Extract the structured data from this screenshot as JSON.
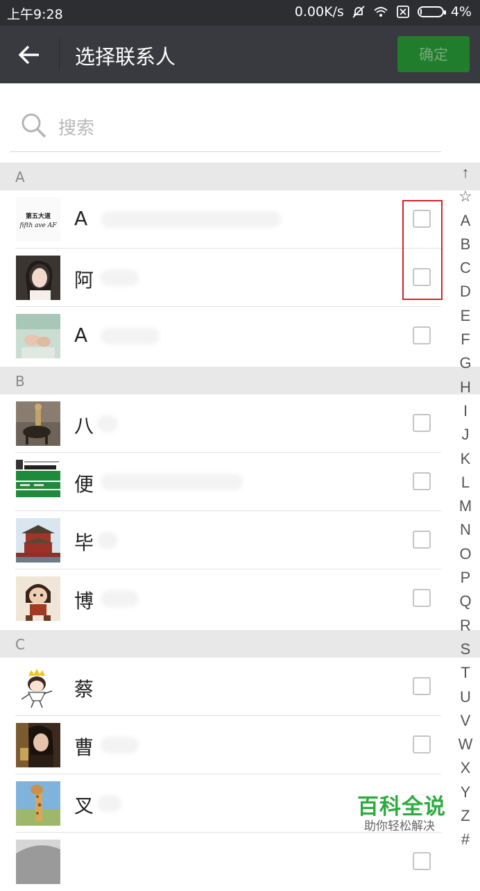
{
  "status_bar": {
    "time": "上午9:28",
    "speed": "0.00K/s",
    "battery_percent": "4%",
    "battery_level": 0.04
  },
  "header": {
    "title": "选择联系人",
    "confirm_label": "确定"
  },
  "search": {
    "placeholder": "搜索"
  },
  "sections": [
    {
      "letter": "A",
      "contacts": [
        {
          "name": "A",
          "avatar": "fifth-ave-logo-avatar",
          "checked": false
        },
        {
          "name": "阿",
          "avatar": "girl-photo-avatar",
          "checked": false
        },
        {
          "name": "A",
          "avatar": "hands-photo-avatar",
          "checked": false
        }
      ]
    },
    {
      "letter": "B",
      "contacts": [
        {
          "name": "八",
          "avatar": "statue-photo-avatar",
          "checked": false
        },
        {
          "name": "便",
          "avatar": "business-card-avatar",
          "checked": false
        },
        {
          "name": "毕",
          "avatar": "pavilion-photo-avatar",
          "checked": false
        },
        {
          "name": "博",
          "avatar": "cartoon-character-avatar",
          "checked": false
        }
      ]
    },
    {
      "letter": "C",
      "contacts": [
        {
          "name": "蔡",
          "avatar": "cartoon-girl-avatar",
          "checked": false
        },
        {
          "name": "曹",
          "avatar": "selfie-photo-avatar",
          "checked": false
        },
        {
          "name": "叉",
          "avatar": "giraffe-photo-avatar",
          "checked": false
        }
      ]
    }
  ],
  "logo_text": {
    "line1": "第五大道",
    "line2": "fifth ave AF"
  },
  "index_bar": [
    "↑",
    "☆",
    "A",
    "B",
    "C",
    "D",
    "E",
    "F",
    "G",
    "H",
    "I",
    "J",
    "K",
    "L",
    "M",
    "N",
    "O",
    "P",
    "Q",
    "R",
    "S",
    "T",
    "U",
    "V",
    "W",
    "X",
    "Y",
    "Z",
    "#"
  ],
  "watermark": {
    "title": "百科全说",
    "subtitle": "助你轻松解决"
  },
  "colors": {
    "header_bg": "#393a3f",
    "status_bg": "#2d2e32",
    "confirm_bg": "#1f7d2b",
    "highlight": "#d3232a",
    "watermark_green": "#2eab3f"
  }
}
